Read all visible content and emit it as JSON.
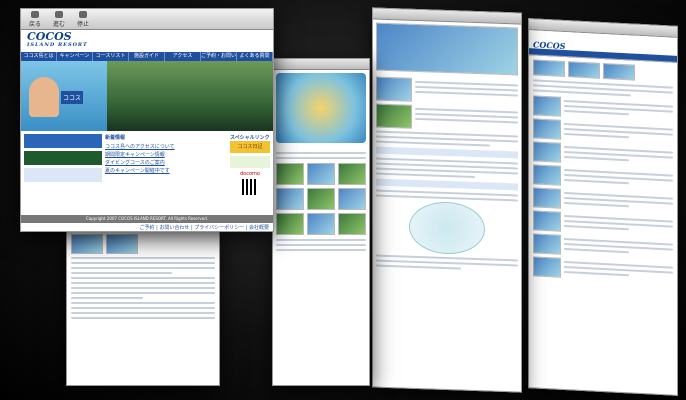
{
  "toolbar": {
    "buttons": [
      {
        "label": "戻る",
        "icon": "back-arrow-icon"
      },
      {
        "label": "進む",
        "icon": "forward-arrow-icon"
      },
      {
        "label": "停止",
        "icon": "stop-icon"
      }
    ]
  },
  "site": {
    "logo_main": "COCOS",
    "logo_sub": "ISLAND RESORT",
    "nav": [
      "ココス島とは",
      "キャンペーン",
      "コースリスト",
      "施設ガイド",
      "アクセス",
      "ご予約・お問い合わせ",
      "よくある質問"
    ],
    "hero_text": "ココス",
    "news_heading": "新着情報",
    "news_links": [
      "ココス島へのアクセスについて",
      "期間限定キャンペーン情報",
      "ダイビングコースのご案内",
      "夏のキャンペーン開催中です"
    ],
    "special_heading": "スペシャルリンク",
    "special_link": "ココス日記",
    "docomo_label": "docomo",
    "copyright": "Copyright 2007 COCOS ISLAND RESORT. All Rights Reserved.",
    "footer_links": "ご予約 | お問い合わせ | プライバシーポリシー | 会社概要"
  },
  "colors": {
    "brand": "#1f4f9e",
    "accent": "#f1c232"
  }
}
